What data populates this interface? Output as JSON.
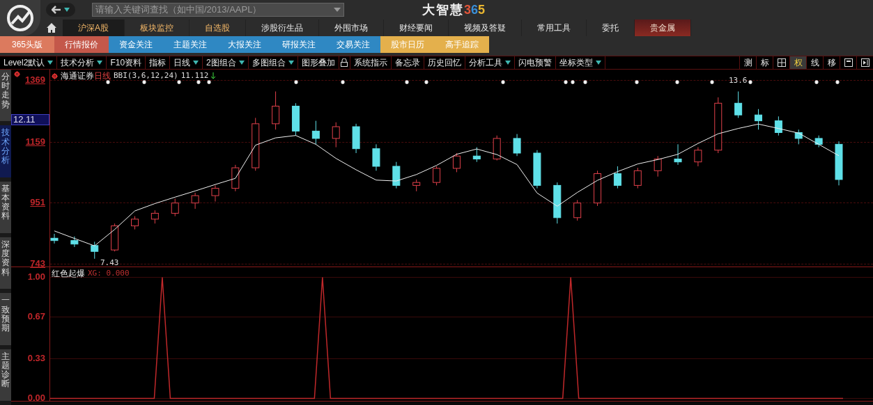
{
  "header": {
    "search": {
      "placeholder": "请输入关键词查找（如中国/2013/AAPL）"
    },
    "brand": {
      "name": "大智慧",
      "number": "365"
    }
  },
  "nav": [
    {
      "label": "沪深A股",
      "kind": "featured",
      "selected": true
    },
    {
      "label": "板块监控",
      "kind": "featured",
      "selected": false
    },
    {
      "label": "自选股",
      "kind": "featured",
      "selected": false
    },
    {
      "label": "涉股衍生品",
      "kind": "normal",
      "selected": false
    },
    {
      "label": "外围市场",
      "kind": "normal",
      "selected": false
    },
    {
      "label": "财经要闻",
      "kind": "normal",
      "selected": false
    },
    {
      "label": "视频及答疑",
      "kind": "normal",
      "selected": false
    },
    {
      "label": "常用工具",
      "kind": "normal",
      "selected": false
    },
    {
      "label": "委托",
      "kind": "normal",
      "selected": false
    },
    {
      "label": "贵金属",
      "kind": "accent",
      "selected": false
    }
  ],
  "subnav": [
    {
      "label": "365头版",
      "color": "#dc7a5e"
    },
    {
      "label": "行情报价",
      "color": "#c4584a"
    },
    {
      "label": "资金关注",
      "color": "#2f88c3"
    },
    {
      "label": "主题关注",
      "color": "#2f88c3"
    },
    {
      "label": "大报关注",
      "color": "#2f88c3"
    },
    {
      "label": "研报关注",
      "color": "#2f88c3"
    },
    {
      "label": "交易关注",
      "color": "#2f88c3"
    },
    {
      "label": "股市日历",
      "color": "#e4b04c"
    },
    {
      "label": "高手追踪",
      "color": "#e4b04c"
    }
  ],
  "toolbar": [
    {
      "label": "Level2默认",
      "kind": "dropdown"
    },
    {
      "label": "技术分析",
      "kind": "dropdown"
    },
    {
      "label": "F10资料",
      "kind": "plain"
    },
    {
      "label": "指标",
      "kind": "plain"
    },
    {
      "label": "日线",
      "kind": "dropdown"
    },
    {
      "label": "2图组合",
      "kind": "dropdown"
    },
    {
      "label": "多图组合",
      "kind": "dropdown"
    },
    {
      "label": "图形叠加",
      "kind": "plain"
    },
    {
      "kind": "lock"
    },
    {
      "label": "系统指示",
      "kind": "plain"
    },
    {
      "label": "备忘录",
      "kind": "plain"
    },
    {
      "label": "历史回忆",
      "kind": "plain"
    },
    {
      "label": "分析工具",
      "kind": "dropdown"
    },
    {
      "label": "闪电预警",
      "kind": "plain"
    },
    {
      "label": "坐标类型",
      "kind": "dropdown"
    }
  ],
  "tools": [
    {
      "kind": "text",
      "label": "测",
      "selected": false
    },
    {
      "kind": "text",
      "label": "标",
      "selected": false
    },
    {
      "kind": "grid",
      "selected": false
    },
    {
      "kind": "text",
      "label": "权",
      "selected": true
    },
    {
      "kind": "text",
      "label": "线",
      "selected": false
    },
    {
      "kind": "text",
      "label": "移",
      "selected": false
    },
    {
      "kind": "window",
      "selected": false
    },
    {
      "kind": "panel",
      "selected": false
    }
  ],
  "side_tabs": [
    {
      "label": "分时走势",
      "selected": false
    },
    {
      "label": "技术分析",
      "selected": true
    },
    {
      "label": "基本资料",
      "selected": false
    },
    {
      "label": "深度资料",
      "selected": false
    },
    {
      "label": "一致预期",
      "selected": false
    },
    {
      "label": "主题诊断",
      "selected": false
    }
  ],
  "main_chart": {
    "stock": "海通证券",
    "period": "日线",
    "indicator": "BBI(3,6,12,24)",
    "indicator_value": "11.112",
    "current_price": "12.11",
    "high_label": "13.6",
    "low_label": "7.43",
    "chart_data": {
      "type": "candlestick",
      "ylim": [
        743,
        1369
      ],
      "yticks": [
        1369,
        1159,
        951,
        743
      ],
      "ohlc": [
        [
          830,
          845,
          812,
          822
        ],
        [
          822,
          836,
          800,
          810
        ],
        [
          805,
          818,
          760,
          785
        ],
        [
          790,
          880,
          785,
          872
        ],
        [
          872,
          905,
          860,
          895
        ],
        [
          895,
          925,
          880,
          915
        ],
        [
          915,
          965,
          905,
          950
        ],
        [
          950,
          985,
          930,
          975
        ],
        [
          975,
          1010,
          955,
          1000
        ],
        [
          1000,
          1080,
          990,
          1070
        ],
        [
          1070,
          1240,
          1060,
          1220
        ],
        [
          1220,
          1330,
          1200,
          1280
        ],
        [
          1280,
          1290,
          1180,
          1195
        ],
        [
          1195,
          1230,
          1150,
          1170
        ],
        [
          1170,
          1225,
          1140,
          1210
        ],
        [
          1210,
          1220,
          1120,
          1135
        ],
        [
          1135,
          1150,
          1060,
          1075
        ],
        [
          1075,
          1090,
          1000,
          1010
        ],
        [
          1010,
          1030,
          990,
          1020
        ],
        [
          1020,
          1075,
          1010,
          1068
        ],
        [
          1068,
          1120,
          1055,
          1110
        ],
        [
          1110,
          1140,
          1090,
          1100
        ],
        [
          1100,
          1180,
          1095,
          1170
        ],
        [
          1170,
          1185,
          1110,
          1120
        ],
        [
          1120,
          1130,
          1000,
          1010
        ],
        [
          1010,
          1020,
          880,
          900
        ],
        [
          900,
          960,
          890,
          950
        ],
        [
          950,
          1060,
          940,
          1050
        ],
        [
          1050,
          1075,
          1000,
          1010
        ],
        [
          1010,
          1070,
          1000,
          1060
        ],
        [
          1060,
          1110,
          1040,
          1100
        ],
        [
          1100,
          1150,
          1080,
          1090
        ],
        [
          1090,
          1140,
          1075,
          1130
        ],
        [
          1130,
          1310,
          1120,
          1290
        ],
        [
          1290,
          1330,
          1240,
          1250
        ],
        [
          1250,
          1270,
          1200,
          1230
        ],
        [
          1230,
          1245,
          1180,
          1190
        ],
        [
          1190,
          1200,
          1150,
          1170
        ],
        [
          1170,
          1180,
          1140,
          1150
        ],
        [
          1150,
          1160,
          1010,
          1030
        ]
      ],
      "series": [
        {
          "type": "line",
          "color": "#f0f0f0",
          "values": [
            855,
            829,
            804,
            860,
            923,
            948,
            970,
            991,
            1013,
            1034,
            1147,
            1172,
            1180,
            1150,
            1102,
            1063,
            1028,
            1025,
            1047,
            1078,
            1116,
            1134,
            1115,
            1081,
            984,
            939,
            986,
            1027,
            1057,
            1083,
            1098,
            1116,
            1153,
            1186,
            1204,
            1219,
            1204,
            1188,
            1150,
            1111
          ]
        }
      ]
    }
  },
  "signal_chart": {
    "title": "红色起爆",
    "reading": "XG: 0.000",
    "chart_data": {
      "type": "line",
      "ylim": [
        0,
        1
      ],
      "yticks": [
        {
          "value": 1,
          "label": "1.00"
        },
        {
          "value": 0.67,
          "label": "0.67"
        },
        {
          "value": 0.33,
          "label": "0.33"
        },
        {
          "value": 0,
          "label": "0.00"
        }
      ],
      "series": [
        {
          "color": "#c0282a",
          "values": [
            0,
            0,
            0,
            0,
            0,
            0,
            0,
            0,
            0,
            0,
            0,
            0,
            0,
            0,
            1,
            0,
            0,
            0,
            0,
            0,
            0,
            0,
            0,
            0,
            0,
            0,
            0,
            0,
            0,
            0,
            0,
            0,
            0,
            0,
            1,
            0,
            0,
            0,
            0,
            0,
            0,
            0,
            0,
            0,
            0,
            0,
            0,
            0,
            0,
            0,
            0,
            0,
            0,
            0,
            0,
            0,
            0,
            0,
            0,
            0,
            0,
            0,
            0,
            0,
            0,
            1,
            0,
            0,
            0,
            0,
            0,
            0,
            0,
            0,
            0,
            0,
            0,
            0,
            0,
            0,
            0,
            0,
            0,
            0,
            0,
            0,
            0,
            0,
            0,
            0,
            0,
            0,
            0,
            0,
            0,
            0,
            0,
            0,
            0,
            0
          ]
        }
      ]
    }
  }
}
